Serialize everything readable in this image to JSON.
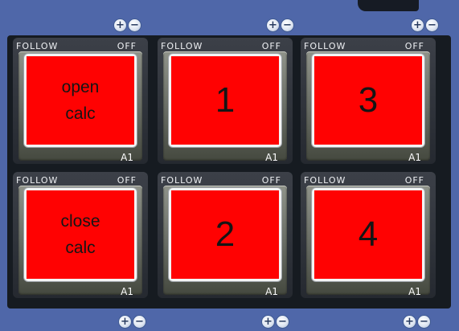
{
  "controls": {
    "plus": "+",
    "minus": "−"
  },
  "pads": [
    {
      "follow": "FOLLOW",
      "state": "OFF",
      "label": "open\ncalc",
      "label_size": "small",
      "tag": "A1",
      "color": "#ff0202"
    },
    {
      "follow": "FOLLOW",
      "state": "OFF",
      "label": "1",
      "label_size": "big",
      "tag": "A1",
      "color": "#ff0202"
    },
    {
      "follow": "FOLLOW",
      "state": "OFF",
      "label": "3",
      "label_size": "big",
      "tag": "A1",
      "color": "#ff0202"
    },
    {
      "follow": "FOLLOW",
      "state": "OFF",
      "label": "close\ncalc",
      "label_size": "small",
      "tag": "A1",
      "color": "#ff0202"
    },
    {
      "follow": "FOLLOW",
      "state": "OFF",
      "label": "2",
      "label_size": "big",
      "tag": "A1",
      "color": "#ff0202"
    },
    {
      "follow": "FOLLOW",
      "state": "OFF",
      "label": "4",
      "label_size": "big",
      "tag": "A1",
      "color": "#ff0202"
    }
  ],
  "colors": {
    "background": "#4f67a9",
    "panel": "#161b21",
    "pad_face": "#ff0202"
  }
}
